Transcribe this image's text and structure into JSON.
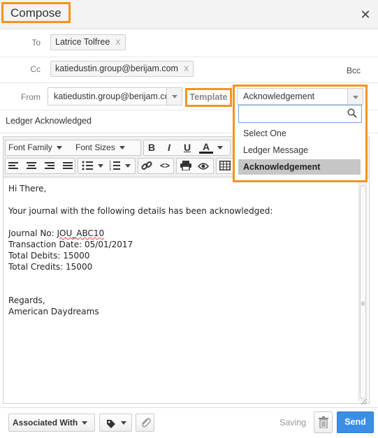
{
  "header": {
    "title": "Compose",
    "close_icon": "close-icon"
  },
  "to": {
    "label": "To",
    "recipients": [
      {
        "name": "Latrice Tolfree",
        "remove": "X"
      }
    ]
  },
  "cc": {
    "label": "Cc",
    "recipients": [
      {
        "name": "katiedustin.group@berijam.com",
        "remove": "X"
      }
    ],
    "bcc_label": "Bcc"
  },
  "from": {
    "label": "From",
    "value": "katiedustin.group@berijam.com"
  },
  "template": {
    "label": "Template",
    "selected": "Acknowledgement",
    "search_placeholder": "",
    "options": [
      "Select One",
      "Ledger Message",
      "Acknowledgement"
    ]
  },
  "subject": "Ledger Acknowledged",
  "toolbar": {
    "font_family": "Font Family",
    "font_sizes": "Font Sizes",
    "bold": "B",
    "italic": "I",
    "underline": "U",
    "text_color": "A"
  },
  "body": {
    "greeting": "Hi There,",
    "intro": "Your journal with the following details has been acknowledged:",
    "journal_prefix": "Journal No: ",
    "journal_no": "JOU_ABC10",
    "transaction_date": "Transaction Date: 05/01/2017",
    "total_debits": "Total Debits: 15000",
    "total_credits": "Total Credits: 15000",
    "regards": "Regards,",
    "signature": "American Daydreams"
  },
  "footer": {
    "associated_with": "Associated With",
    "saving": "Saving",
    "send": "Send"
  },
  "colors": {
    "highlight": "#f3941e",
    "send_button": "#3a8ee6",
    "selected_option": "#c6c6c6"
  }
}
